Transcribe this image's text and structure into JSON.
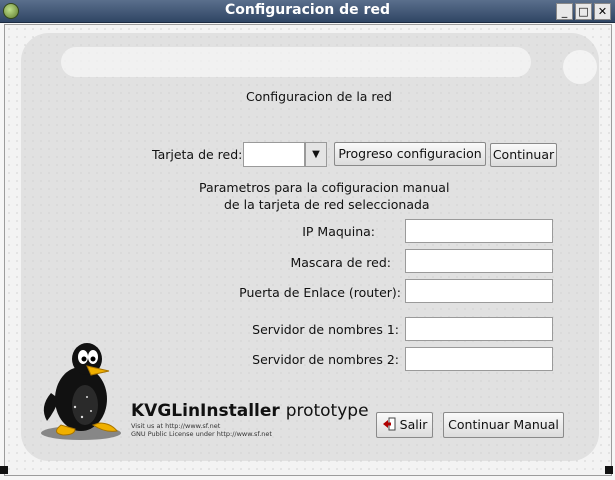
{
  "window": {
    "title": "Configuracion de red"
  },
  "titlebar": {
    "minimize": "_",
    "maximize": "□",
    "close": "✕"
  },
  "heading": "Configuracion de la red",
  "card": {
    "label": "Tarjeta de red:",
    "selected": "",
    "arrow": "▼",
    "progress_button": "Progreso configuracion",
    "continue_button": "Continuar"
  },
  "manual": {
    "description_line1": "Parametros para la cofiguracion manual",
    "description_line2": "de la tarjeta de red seleccionada",
    "fields": [
      {
        "label": "IP Maquina:",
        "value": ""
      },
      {
        "label": "Mascara de red:",
        "value": ""
      },
      {
        "label": "Puerta de Enlace (router):",
        "value": ""
      },
      {
        "label": "Servidor de nombres 1:",
        "value": ""
      },
      {
        "label": "Servidor de nombres 2:",
        "value": ""
      }
    ]
  },
  "logo": {
    "name": "KVGLinInstaller",
    "suffix": "prototype",
    "line1": "Visit us at http://www.sf.net",
    "line2": "GNU Public License under http://www.sf.net"
  },
  "actions": {
    "exit": "Salir",
    "continue_manual": "Continuar Manual"
  },
  "colors": {
    "titlebar": "#3d5270",
    "accent": "#b00000"
  }
}
